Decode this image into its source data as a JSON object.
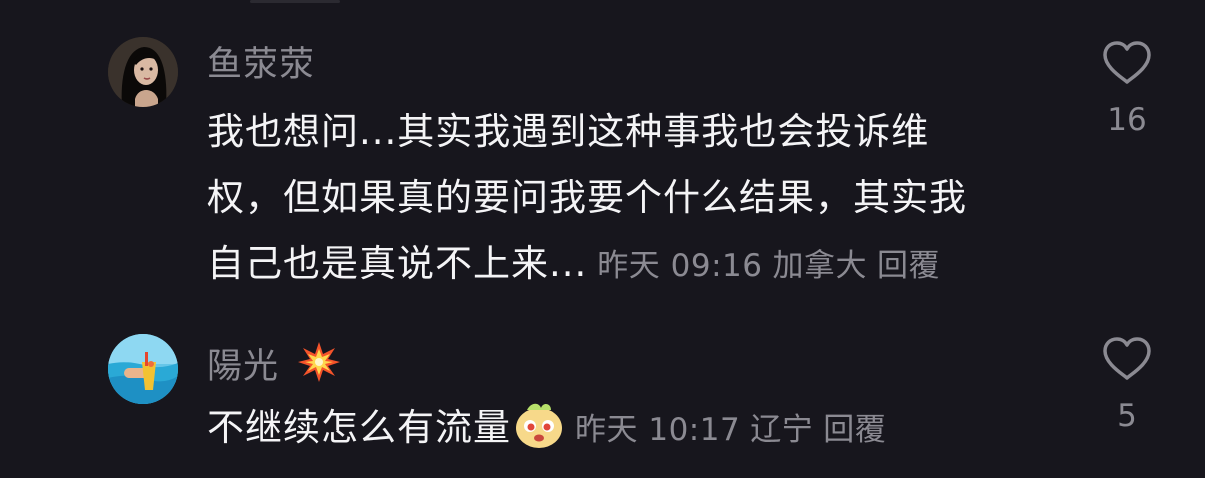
{
  "comments": [
    {
      "username": "鱼荥荥",
      "text_lines": [
        "我也想问...其实我遇到这种事我也会投诉维",
        "权，但如果真的要问我要个什么结果，其实我",
        "自己也是真说不上来..."
      ],
      "time": "昨天 09:16",
      "location": "加拿大",
      "reply_label": "回覆",
      "like_count": "16",
      "avatar_icon": "woman-portrait-avatar",
      "like_icon": "heart-outline-icon"
    },
    {
      "username": "陽光",
      "username_badge_icon": "explosion-emoji-icon",
      "text": "不继续怎么有流量",
      "inline_emoji_icon": "cute-sticker-emoji-icon",
      "time": "昨天 10:17",
      "location": "辽宁",
      "reply_label": "回覆",
      "like_count": "5",
      "avatar_icon": "beach-drink-avatar",
      "like_icon": "heart-outline-icon"
    }
  ],
  "colors": {
    "background": "#17161d",
    "primary_text": "#f4f4f6",
    "secondary_text": "#8b8a92"
  }
}
